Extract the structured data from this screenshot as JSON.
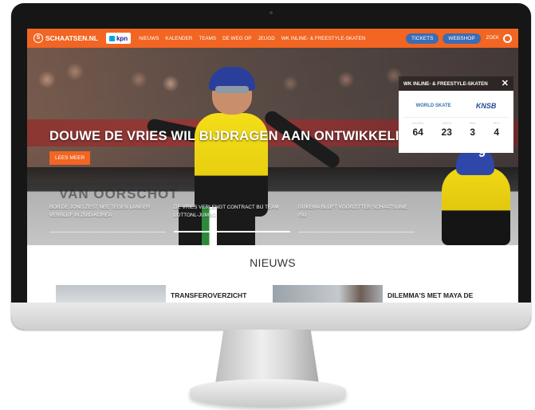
{
  "site": {
    "brand": "SCHAATSEN.NL",
    "brand_mark": "S",
    "sponsor": "kpn"
  },
  "nav": {
    "items": [
      "NIEUWS",
      "KALENDER",
      "TEAMS",
      "DE WEG OP",
      "JEUGD",
      "WK INLINE- & FREESTYLE-SKATEN"
    ],
    "tickets": "TICKETS",
    "webshop": "WEBSHOP",
    "search_label": "ZOEK"
  },
  "hero": {
    "title": "DOUWE DE VRIES WIL BIJDRAGEN AAN ONTWIKKELING 'JONKIES'",
    "cta": "LEES MEER",
    "board_text": "VAN OORSCHOT",
    "headlines": [
      "BOB DE JONG ZEST NEE TEGEN LANGER VERBLIJF IN ZUID-KOREA",
      "DE VRIES VERLENGT CONTRACT BIJ TEAM LOTTONL-JUMBO",
      "DIJKEMA BLIJFT VOORZITTER SCHAATSUNIE ISU"
    ],
    "skater2_number": "9"
  },
  "widget": {
    "title": "WK INLINE- & FREESTYLE-SKATEN",
    "logo_left": "WORLD SKATE",
    "logo_right": "KNSB",
    "countdown": [
      {
        "label": "DAGEN",
        "value": "64"
      },
      {
        "label": "UREN",
        "value": "23"
      },
      {
        "label": "MIN",
        "value": "3"
      },
      {
        "label": "SEC",
        "value": "4"
      }
    ]
  },
  "news": {
    "section_title": "NIEUWS",
    "cards": [
      {
        "title": "TRANSFEROVERZICHT"
      },
      {
        "title": "DILEMMA'S MET MAYA DE"
      }
    ]
  },
  "device": {
    "apple_logo": ""
  },
  "colors": {
    "accent": "#f26522",
    "pill": "#3b6cb6"
  }
}
